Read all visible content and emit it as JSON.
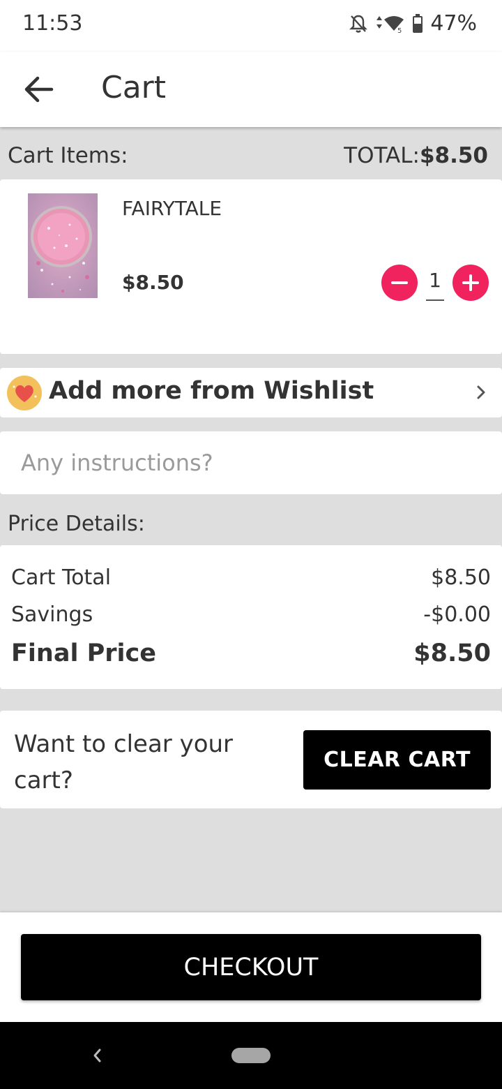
{
  "status_bar": {
    "time": "11:53",
    "battery": "47%"
  },
  "header": {
    "title": "Cart"
  },
  "cart_summary": {
    "label": "Cart Items:",
    "total_label": "TOTAL:",
    "total_value": "$8.50"
  },
  "items": [
    {
      "name": "FAIRYTALE",
      "price": "$8.50",
      "quantity": "1"
    }
  ],
  "wishlist": {
    "label": "Add more from Wishlist"
  },
  "instructions": {
    "placeholder": "Any instructions?"
  },
  "price_details": {
    "heading": "Price Details:",
    "cart_total_label": "Cart Total",
    "cart_total_value": "$8.50",
    "savings_label": "Savings",
    "savings_value": "-$0.00",
    "final_label": "Final Price",
    "final_value": "$8.50"
  },
  "clear": {
    "prompt": "Want to clear your cart?",
    "button": "CLEAR CART"
  },
  "checkout": {
    "button": "CHECKOUT"
  },
  "colors": {
    "accent": "#f0235f",
    "button_bg": "#000000",
    "background": "#dedede"
  }
}
